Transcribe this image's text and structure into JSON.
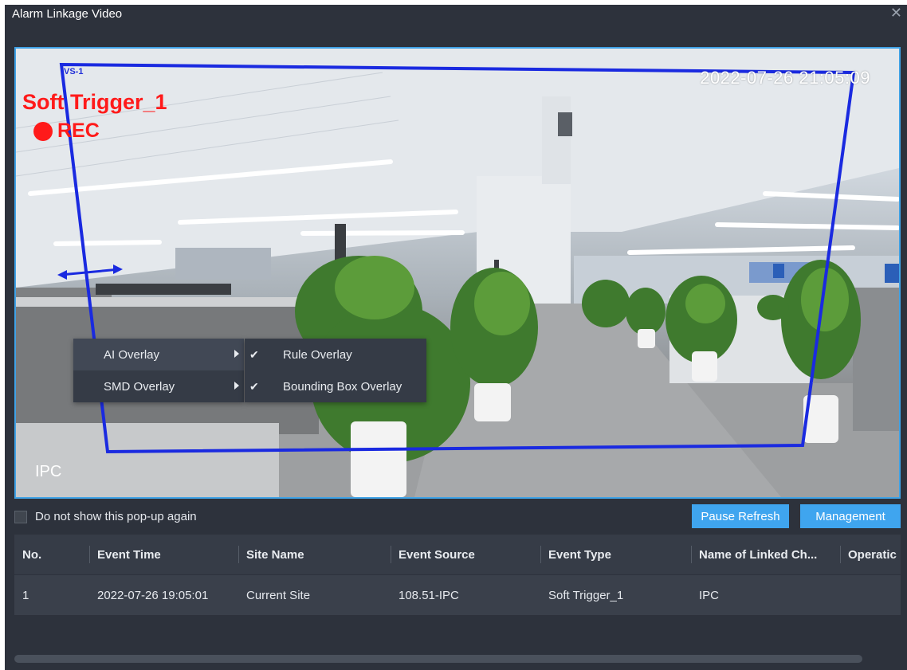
{
  "window": {
    "title": "Alarm Linkage Video",
    "close_icon": "close-icon"
  },
  "video": {
    "timestamp": "2022-07-26 21:05:09",
    "trigger_label": "Soft Trigger_1",
    "rec_label": "REC",
    "rule_tag": "VS-1",
    "channel_label": "IPC",
    "colors": {
      "rule_line": "#1a2ae0",
      "osd_red": "#ff1a1a",
      "border": "#3fa2e6"
    }
  },
  "context_menu": {
    "items": [
      {
        "label": "AI Overlay",
        "icon": "chevron-right-icon"
      },
      {
        "label": "SMD Overlay",
        "icon": "chevron-right-icon"
      }
    ],
    "submenu": [
      {
        "label": "Rule Overlay",
        "checked": true,
        "icon": "check-icon"
      },
      {
        "label": "Bounding Box Overlay",
        "checked": true,
        "icon": "check-icon"
      }
    ]
  },
  "footer": {
    "dont_show_label": "Do not show this pop-up again",
    "pause_refresh_label": "Pause Refresh",
    "management_label": "Management",
    "accent": "#3fa5ef"
  },
  "table": {
    "headers": [
      "No.",
      "Event Time",
      "Site Name",
      "Event Source",
      "Event Type",
      "Name of Linked Ch...",
      "Operatic"
    ],
    "rows": [
      [
        "1",
        "2022-07-26 19:05:01",
        "Current Site",
        "108.51-IPC",
        "Soft Trigger_1",
        "IPC",
        ""
      ]
    ]
  }
}
